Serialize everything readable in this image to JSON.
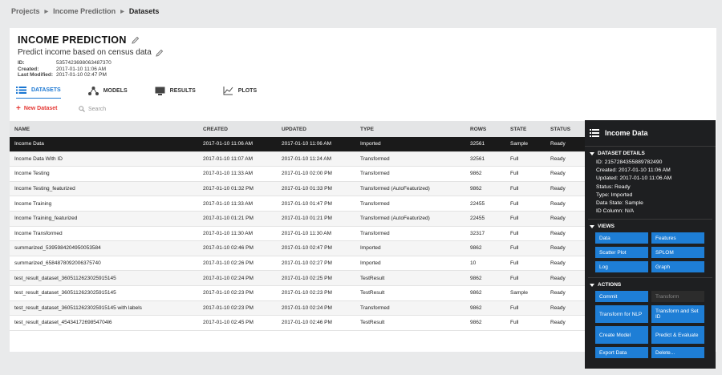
{
  "breadcrumb": {
    "projects": "Projects",
    "project": "Income Prediction",
    "current": "Datasets"
  },
  "project": {
    "title": "INCOME PREDICTION",
    "description": "Predict income based on census data",
    "meta": [
      {
        "key": "ID:",
        "value": "5357423698063487370"
      },
      {
        "key": "Created:",
        "value": "2017-01-10 11:06 AM"
      },
      {
        "key": "Last Modified:",
        "value": "2017-01-10 02:47 PM"
      }
    ]
  },
  "tabs": [
    {
      "label": "DATASETS",
      "icon": "list-icon",
      "active": true
    },
    {
      "label": "MODELS",
      "icon": "models-icon",
      "active": false
    },
    {
      "label": "RESULTS",
      "icon": "results-icon",
      "active": false
    },
    {
      "label": "PLOTS",
      "icon": "plots-icon",
      "active": false
    }
  ],
  "toolbar": {
    "new_dataset": "New Dataset",
    "search_placeholder": "Search"
  },
  "table": {
    "headers": [
      "NAME",
      "CREATED",
      "UPDATED",
      "TYPE",
      "ROWS",
      "STATE",
      "STATUS"
    ],
    "rows": [
      [
        "Income Data",
        "2017-01-10 11:06 AM",
        "2017-01-10 11:06 AM",
        "Imported",
        "32561",
        "Sample",
        "Ready"
      ],
      [
        "Income Data With ID",
        "2017-01-10 11:07 AM",
        "2017-01-10 11:24 AM",
        "Transformed",
        "32561",
        "Full",
        "Ready"
      ],
      [
        "Income Testing",
        "2017-01-10 11:33 AM",
        "2017-01-10 02:00 PM",
        "Transformed",
        "9862",
        "Full",
        "Ready"
      ],
      [
        "Income Testing_featurized",
        "2017-01-10 01:32 PM",
        "2017-01-10 01:33 PM",
        "Transformed (AutoFeaturized)",
        "9862",
        "Full",
        "Ready"
      ],
      [
        "Income Training",
        "2017-01-10 11:33 AM",
        "2017-01-10 01:47 PM",
        "Transformed",
        "22455",
        "Full",
        "Ready"
      ],
      [
        "Income Training_featurized",
        "2017-01-10 01:21 PM",
        "2017-01-10 01:21 PM",
        "Transformed (AutoFeaturized)",
        "22455",
        "Full",
        "Ready"
      ],
      [
        "Income Transformed",
        "2017-01-10 11:30 AM",
        "2017-01-10 11:30 AM",
        "Transformed",
        "32317",
        "Full",
        "Ready"
      ],
      [
        "summarized_5395984204950053584",
        "2017-01-10 02:46 PM",
        "2017-01-10 02:47 PM",
        "Imported",
        "9862",
        "Full",
        "Ready"
      ],
      [
        "summarized_6584878092006375740",
        "2017-01-10 02:26 PM",
        "2017-01-10 02:27 PM",
        "Imported",
        "10",
        "Full",
        "Ready"
      ],
      [
        "test_result_dataset_3605112623025915145",
        "2017-01-10 02:24 PM",
        "2017-01-10 02:25 PM",
        "TestResult",
        "9862",
        "Full",
        "Ready"
      ],
      [
        "test_result_dataset_3605112623025915145",
        "2017-01-10 02:23 PM",
        "2017-01-10 02:23 PM",
        "TestResult",
        "9862",
        "Sample",
        "Ready"
      ],
      [
        "test_result_dataset_3605112623025915145 with labels",
        "2017-01-10 02:23 PM",
        "2017-01-10 02:24 PM",
        "Transformed",
        "9862",
        "Full",
        "Ready"
      ],
      [
        "test_result_dataset_4543417269854704l6",
        "2017-01-10 02:45 PM",
        "2017-01-10 02:46 PM",
        "TestResult",
        "9862",
        "Full",
        "Ready"
      ]
    ]
  },
  "panel": {
    "title": "Income Data",
    "details_title": "DATASET DETAILS",
    "details": [
      "ID: 2157284355889782490",
      "Created: 2017-01-10 11:06 AM",
      "Updated: 2017-01-10 11:06 AM",
      "Status: Ready",
      "Type: Imported",
      "Data State: Sample",
      "ID Column: N/A"
    ],
    "views_title": "VIEWS",
    "views": [
      "Data",
      "Features",
      "Scatter Plot",
      "SPLOM",
      "Log",
      "Graph"
    ],
    "actions_title": "ACTIONS",
    "actions": [
      {
        "label": "Commit",
        "enabled": true
      },
      {
        "label": "Transform",
        "enabled": false
      },
      {
        "label": "Transform for NLP",
        "enabled": true
      },
      {
        "label": "Transform and Set ID",
        "enabled": true
      },
      {
        "label": "Create Model",
        "enabled": true
      },
      {
        "label": "Predict & Evaluate",
        "enabled": true
      },
      {
        "label": "Export Data",
        "enabled": true
      },
      {
        "label": "Delete...",
        "enabled": true
      }
    ]
  },
  "colors": {
    "accent": "#1976d2",
    "panel_bg": "#1e1f21",
    "button_blue": "#1e7ed6",
    "new_dataset_red": "#e53935"
  }
}
